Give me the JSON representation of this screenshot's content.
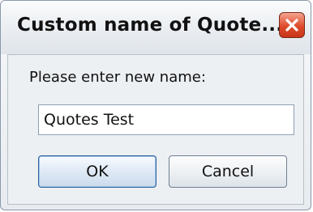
{
  "dialog": {
    "title": "Custom name of Quote...",
    "prompt": "Please enter new name:",
    "name_value": "Quotes Test",
    "ok_label": "OK",
    "cancel_label": "Cancel"
  },
  "icons": {
    "close": "close-icon"
  },
  "colors": {
    "close_button": "#de4b2c",
    "ok_border": "#2f5f9a",
    "window_bg": "#edf0f3"
  }
}
